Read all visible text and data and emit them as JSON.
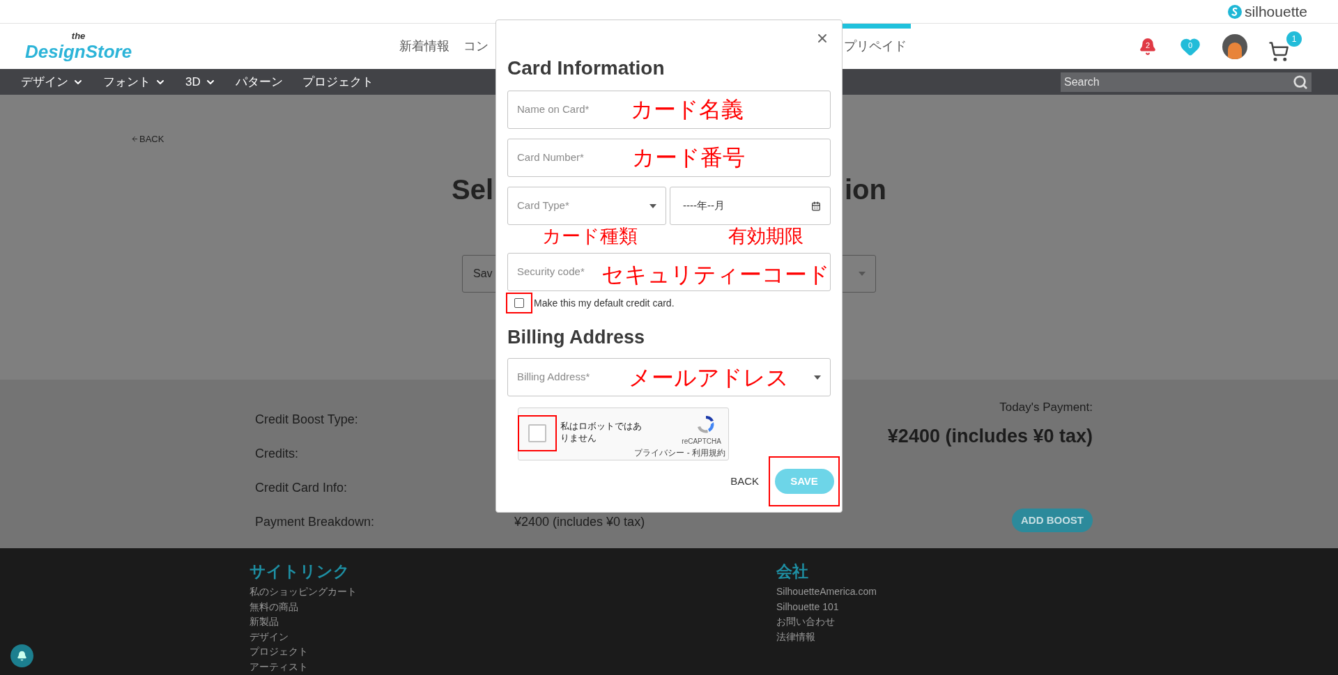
{
  "top_bar": {
    "brand": "silhouette"
  },
  "header": {
    "logo": {
      "small": "the",
      "main": "DesignStore"
    },
    "nav_links": [
      {
        "label": "新着情報",
        "selected": false
      },
      {
        "label": "コン",
        "selected": false
      },
      {
        "label": "プリペイド",
        "selected": true
      }
    ],
    "notifications_count": "2",
    "favorites_count": "0",
    "cart_count": "1"
  },
  "category_nav": {
    "items": [
      {
        "label": "デザイン",
        "dropdown": true
      },
      {
        "label": "フォント",
        "dropdown": true
      },
      {
        "label": "3D",
        "dropdown": true
      },
      {
        "label": "パターン",
        "dropdown": false
      },
      {
        "label": "プロジェクト",
        "dropdown": false
      }
    ],
    "search": {
      "placeholder": "Search"
    }
  },
  "page": {
    "back_link": "BACK",
    "title_fragments": [
      "Sel",
      "ion"
    ],
    "saved_card_select": {
      "value": "Sav"
    },
    "summary": [
      {
        "label": "Credit Boost Type:"
      },
      {
        "label": "Credits:"
      },
      {
        "label": "Credit Card Info:"
      },
      {
        "label": "Payment Breakdown:",
        "value": "¥2400 (includes ¥0 tax)"
      }
    ],
    "todays_payment": {
      "label": "Today's Payment:",
      "amount": "¥2400 (includes ¥0 tax)"
    },
    "add_boost_button": "ADD BOOST"
  },
  "modal": {
    "title": "Card Information",
    "fields": [
      {
        "kind": "text",
        "placeholder": "Name on Card*"
      },
      {
        "kind": "text",
        "placeholder": "Card Number*"
      },
      {
        "kind": "select",
        "placeholder": "Card Type*"
      },
      {
        "kind": "month",
        "value": "----年--月"
      },
      {
        "kind": "text",
        "placeholder": "Security code*"
      }
    ],
    "default_card": {
      "label": "Make this my default credit card.",
      "checked": false
    },
    "billing_title": "Billing Address",
    "billing_select": {
      "placeholder": "Billing Address*"
    },
    "recaptcha": {
      "label": "私はロボットではありません",
      "brand": "reCAPTCHA",
      "links": "プライバシー - 利用規約",
      "checked": false
    },
    "back_button": "BACK",
    "save_button": "SAVE"
  },
  "annotations": [
    "カード名義",
    "カード番号",
    "カード種類",
    "有効期限",
    "セキュリティーコード",
    "メールアドレス"
  ],
  "footer": {
    "columns": [
      {
        "title": "サイトリンク",
        "links": [
          "私のショッピングカート",
          "無料の商品",
          "新製品",
          "デザイン",
          "プロジェクト",
          "アーティスト"
        ]
      },
      {
        "title": "会社",
        "links": [
          "SilhouetteAmerica.com",
          "Silhouette 101",
          "お問い合わせ",
          "法律情報"
        ]
      }
    ]
  }
}
